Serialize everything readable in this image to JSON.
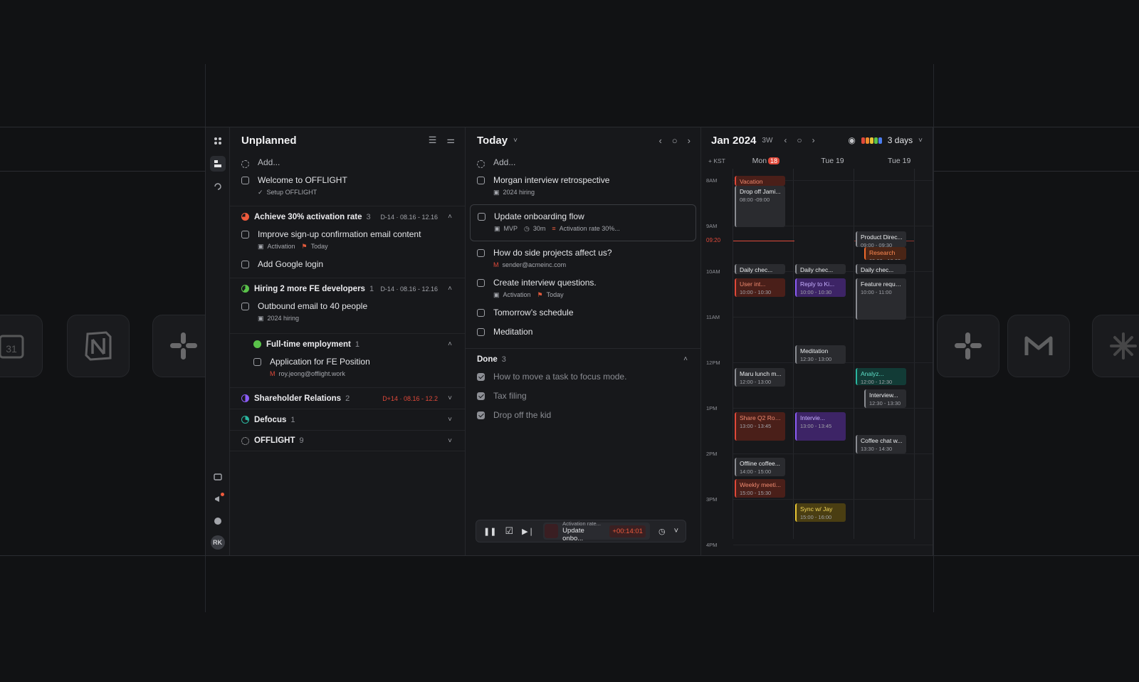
{
  "unplanned": {
    "title": "Unplanned",
    "add": "Add...",
    "tasks": [
      {
        "title": "Welcome to OFFLIGHT",
        "meta": "Setup OFFLIGHT"
      }
    ],
    "groups": [
      {
        "name": "Achieve 30% activation rate",
        "count": "3",
        "meta": "D-14 · 08.16 - 12.16",
        "color": "#ef5a3c",
        "tasks": [
          {
            "title": "Improve sign-up confirmation email content",
            "meta": "Activation",
            "flag": "Today"
          },
          {
            "title": "Add Google login"
          }
        ]
      },
      {
        "name": "Hiring 2 more FE developers",
        "count": "1",
        "meta": "D-14 · 08.16 - 12.16",
        "color": "#5ac24a",
        "tasks": [
          {
            "title": "Outbound email to 40 people",
            "meta": "2024 hiring"
          }
        ],
        "subgroup": {
          "name": "Full-time employment",
          "count": "1",
          "tasks": [
            {
              "title": "Application for FE Position",
              "meta": "roy.jeong@offlight.work"
            }
          ]
        }
      },
      {
        "name": "Shareholder Relations",
        "count": "2",
        "meta": "D+14 · 08.16 - 12.2",
        "color": "#8b5cf6"
      },
      {
        "name": "Defocus",
        "count": "1",
        "meta": "",
        "color": "#2bb6a0"
      },
      {
        "name": "OFFLIGHT",
        "count": "9",
        "meta": "",
        "color": "#bbbbbb"
      }
    ]
  },
  "today": {
    "title": "Today",
    "add": "Add...",
    "tasks": [
      {
        "title": "Morgan interview retrospective",
        "meta": "2024 hiring"
      },
      {
        "title": "Update onboarding flow",
        "meta": "MVP",
        "duration": "30m",
        "goal": "Activation rate 30%..."
      },
      {
        "title": "How do side projects affect us?",
        "meta": "sender@acmeinc.com"
      },
      {
        "title": "Create interview questions.",
        "meta": "Activation",
        "flag": "Today"
      },
      {
        "title": "Tomorrow’s schedule"
      },
      {
        "title": "Meditation"
      }
    ],
    "done_label": "Done",
    "done_count": "3",
    "done": [
      "How to move a task to focus mode.",
      "Tax filing",
      "Drop off the kid"
    ],
    "player": {
      "goal": "Activation rate...",
      "task": "Update onbo...",
      "time": "+00:14:01"
    }
  },
  "calendar": {
    "title": "Jan 2024",
    "week": "3W",
    "view": "3 days",
    "tz": "+ KST",
    "days": [
      {
        "label": "Mon",
        "badge": "18"
      },
      {
        "label": "Tue 19",
        "badge": ""
      },
      {
        "label": "Tue 19",
        "badge": ""
      }
    ],
    "hours": [
      "8AM",
      "9AM",
      "10AM",
      "11AM",
      "12PM",
      "1PM",
      "2PM",
      "3PM",
      "4PM"
    ],
    "now": "09:20",
    "events": [
      {
        "day": 0,
        "title": "Vacation",
        "time": "",
        "color": "red"
      },
      {
        "day": 0,
        "title": "Drop off Jami...",
        "time": "08:00 -09:00",
        "color": "gray"
      },
      {
        "day": 2,
        "title": "Product Direc...",
        "time": "09:00 - 09:30",
        "color": "gray"
      },
      {
        "day": 2,
        "title": "Research",
        "time": "09:20 - 10:00",
        "color": "orange"
      },
      {
        "day": 0,
        "title": "Daily chec...",
        "time": "",
        "color": "gray"
      },
      {
        "day": 1,
        "title": "Daily chec...",
        "time": "",
        "color": "gray"
      },
      {
        "day": 2,
        "title": "Daily chec...",
        "time": "",
        "color": "gray"
      },
      {
        "day": 0,
        "title": "User int...",
        "time": "10:00 - 10:30",
        "color": "red"
      },
      {
        "day": 1,
        "title": "Reply to Ki...",
        "time": "10:00 - 10:30",
        "color": "purple"
      },
      {
        "day": 2,
        "title": "Feature reque...",
        "time": "10:00 - 11:00",
        "color": "gray"
      },
      {
        "day": 1,
        "title": "Meditation",
        "time": "12:30 - 13:00",
        "color": "gray"
      },
      {
        "day": 0,
        "title": "Maru lunch m...",
        "time": "12:00 - 13:00",
        "color": "gray"
      },
      {
        "day": 2,
        "title": "Analyz...",
        "time": "12:00 - 12:30",
        "color": "teal"
      },
      {
        "day": 2,
        "title": "Interview...",
        "time": "12:30 - 13:30",
        "color": "gray"
      },
      {
        "day": 0,
        "title": "Share Q2 Roa...",
        "time": "13:00 - 13:45",
        "color": "red"
      },
      {
        "day": 1,
        "title": "Intervie...",
        "time": "13:00 - 13:45",
        "color": "purple"
      },
      {
        "day": 2,
        "title": "Coffee chat w...",
        "time": "13:30 - 14:30",
        "color": "gray"
      },
      {
        "day": 0,
        "title": "Offline coffee...",
        "time": "14:00 - 15:00",
        "color": "gray"
      },
      {
        "day": 0,
        "title": "Weekly meeti...",
        "time": "15:00 - 15:30",
        "color": "red"
      },
      {
        "day": 1,
        "title": "Sync w/ Jay",
        "time": "15:00 - 16:00",
        "color": "yellow"
      }
    ]
  },
  "rail": {
    "avatar": "RK"
  },
  "tiles": [
    "calendar-icon",
    "notion-icon",
    "slack-icon",
    "slack-icon",
    "gmail-icon",
    "claude-icon"
  ],
  "tile_calendar_num": "31"
}
